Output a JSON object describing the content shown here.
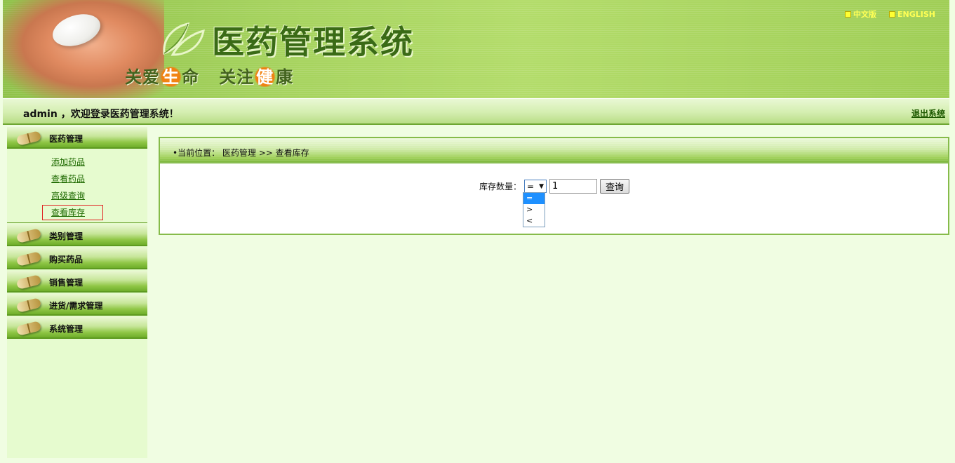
{
  "header": {
    "system_title": "医药管理系统",
    "slogan_part1": "关爱",
    "slogan_hl1": "生",
    "slogan_part2": "命",
    "slogan_part3": "关注",
    "slogan_hl2": "健",
    "slogan_part4": "康",
    "lang_cn": "中文版",
    "lang_en": "ENGLISH"
  },
  "welcome": {
    "text": "admin ，欢迎登录医药管理系统！",
    "logout": "退出系统"
  },
  "sidebar": {
    "groups": [
      {
        "label": "医药管理"
      },
      {
        "label": "类别管理"
      },
      {
        "label": "购买药品"
      },
      {
        "label": "销售管理"
      },
      {
        "label": "进货/需求管理"
      },
      {
        "label": "系统管理"
      }
    ],
    "sub_items": [
      {
        "label": "添加药品"
      },
      {
        "label": "查看药品"
      },
      {
        "label": "高级查询"
      },
      {
        "label": "查看库存"
      }
    ]
  },
  "main": {
    "breadcrumb": "•当前位置： 医药管理 >> 查看库存",
    "stock_label": "库存数量：",
    "operator_selected": "=",
    "quantity_value": "1",
    "query_button": "查询",
    "operator_options": [
      "=",
      ">",
      "<"
    ]
  },
  "colors": {
    "banner_green": "#a6d35e",
    "title_green": "#3a6b16",
    "highlight_orange": "#f08010",
    "link_green": "#1e6a00",
    "selected_box": "#e02020",
    "dropdown_active": "#1e90ff"
  }
}
